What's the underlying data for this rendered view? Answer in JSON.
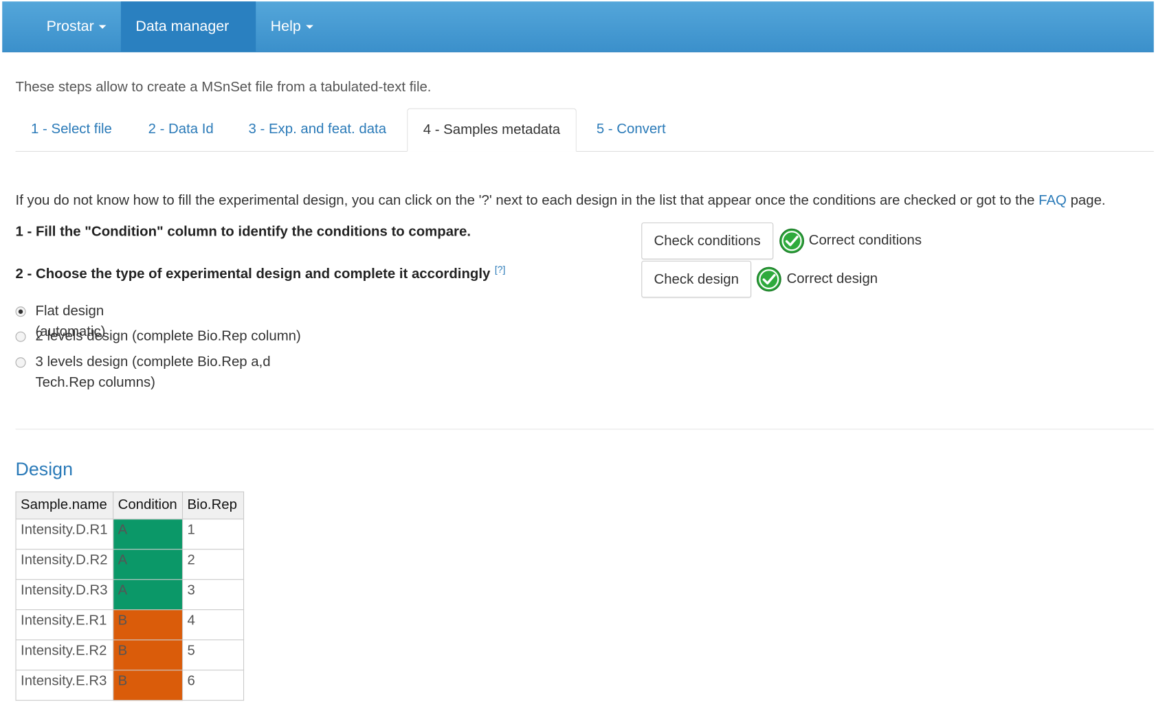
{
  "navbar": {
    "items": [
      {
        "label": "Prostar"
      },
      {
        "label": "Data manager"
      },
      {
        "label": "Help"
      }
    ]
  },
  "intro": "These steps allow to create a MSnSet file from a tabulated-text file.",
  "tabs": [
    {
      "label": "1 - Select file"
    },
    {
      "label": "2 - Data Id"
    },
    {
      "label": "3 - Exp. and feat. data"
    },
    {
      "label": "4 - Samples metadata"
    },
    {
      "label": "5 - Convert"
    }
  ],
  "help": {
    "text_before": "If you do not know how to fill the experimental design, you can click on the '?' next to each design in the list that appear once the conditions are checked or got to the",
    "link": "FAQ",
    "text_after": "page."
  },
  "steps": {
    "step1": "1 - Fill the \"Condition\" column to identify the conditions to compare.",
    "step2": "2 - Choose the type of experimental design and complete it accordingly",
    "step2_help": "[?]"
  },
  "design_options": [
    {
      "label": "Flat design (automatic)",
      "checked": true
    },
    {
      "label": "2 levels design (complete Bio.Rep column)",
      "checked": false
    },
    {
      "label_line1": "3 levels design (complete Bio.Rep a,d",
      "label_line2": "Tech.Rep columns)",
      "checked": false
    }
  ],
  "buttons": {
    "check_conditions": "Check conditions",
    "check_design": "Check design"
  },
  "status": {
    "conditions": "Correct conditions",
    "design": "Correct design",
    "ok_color": "#2eaa3c"
  },
  "design_section": {
    "title": "Design",
    "headers": [
      "Sample.name",
      "Condition",
      "Bio.Rep"
    ],
    "rows": [
      [
        "Intensity.D.R1",
        "A",
        "1"
      ],
      [
        "Intensity.D.R2",
        "A",
        "2"
      ],
      [
        "Intensity.D.R3",
        "A",
        "3"
      ],
      [
        "Intensity.E.R1",
        "B",
        "4"
      ],
      [
        "Intensity.E.R2",
        "B",
        "5"
      ],
      [
        "Intensity.E.R3",
        "B",
        "6"
      ]
    ],
    "condition_colors": {
      "A": "#0b9868",
      "B": "#da5c0a"
    }
  }
}
